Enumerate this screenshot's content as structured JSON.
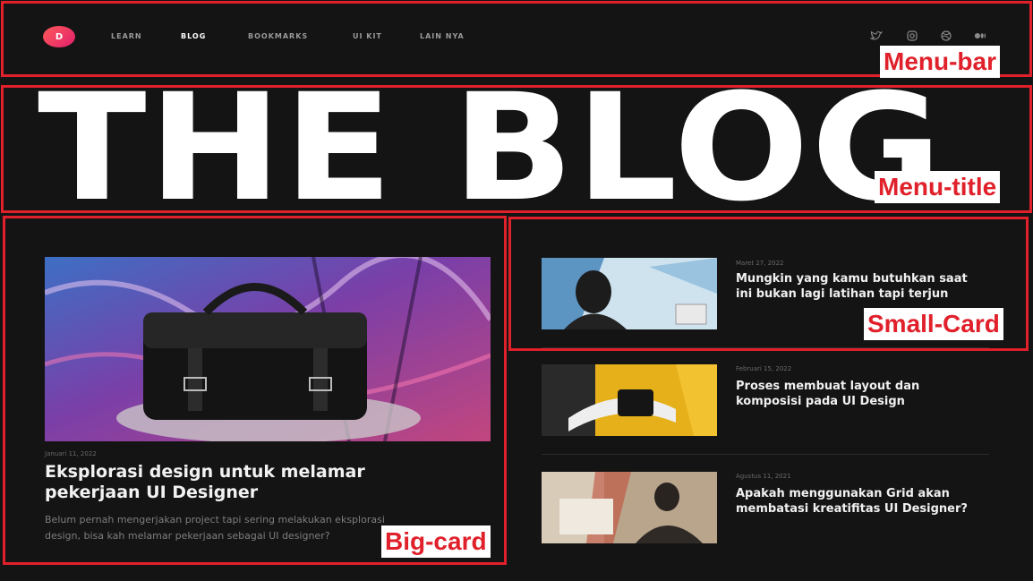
{
  "nav": {
    "logo_letter": "D",
    "items": [
      {
        "label": "LEARN",
        "active": false
      },
      {
        "label": "BLOG",
        "active": true
      },
      {
        "label": "BOOKMARKS",
        "active": false
      },
      {
        "label": "UI KIT",
        "active": false
      },
      {
        "label": "LAIN NYA",
        "active": false
      }
    ],
    "social_icons": [
      "twitter-icon",
      "instagram-icon",
      "dribbble-icon",
      "medium-icon"
    ]
  },
  "hero": {
    "title": "THE BLOG"
  },
  "big_card": {
    "date": "Januari 11, 2022",
    "headline": "Eksplorasi design untuk melamar pekerjaan UI Designer",
    "excerpt": "Belum pernah mengerjakan project tapi sering melakukan eksplorasi design, bisa kah melamar pekerjaan sebagai UI designer?"
  },
  "small_cards": [
    {
      "date": "Maret 27, 2022",
      "headline": "Mungkin yang kamu butuhkan saat ini bukan lagi latihan tapi terjun"
    },
    {
      "date": "Februari 15, 2022",
      "headline": "Proses membuat layout dan komposisi pada UI Design"
    },
    {
      "date": "Agustus 11, 2021",
      "headline": "Apakah menggunakan Grid akan membatasi kreatifitas UI Designer?"
    }
  ],
  "annotations": {
    "menu_bar": "Menu-bar",
    "menu_title": "Menu-title",
    "big_card": "Big-card",
    "small_card": "Small-Card"
  },
  "colors": {
    "background": "#141414",
    "annotation_red": "#e0202a",
    "logo_gradient_start": "#ff5a5a",
    "logo_gradient_end": "#e01f6c"
  }
}
